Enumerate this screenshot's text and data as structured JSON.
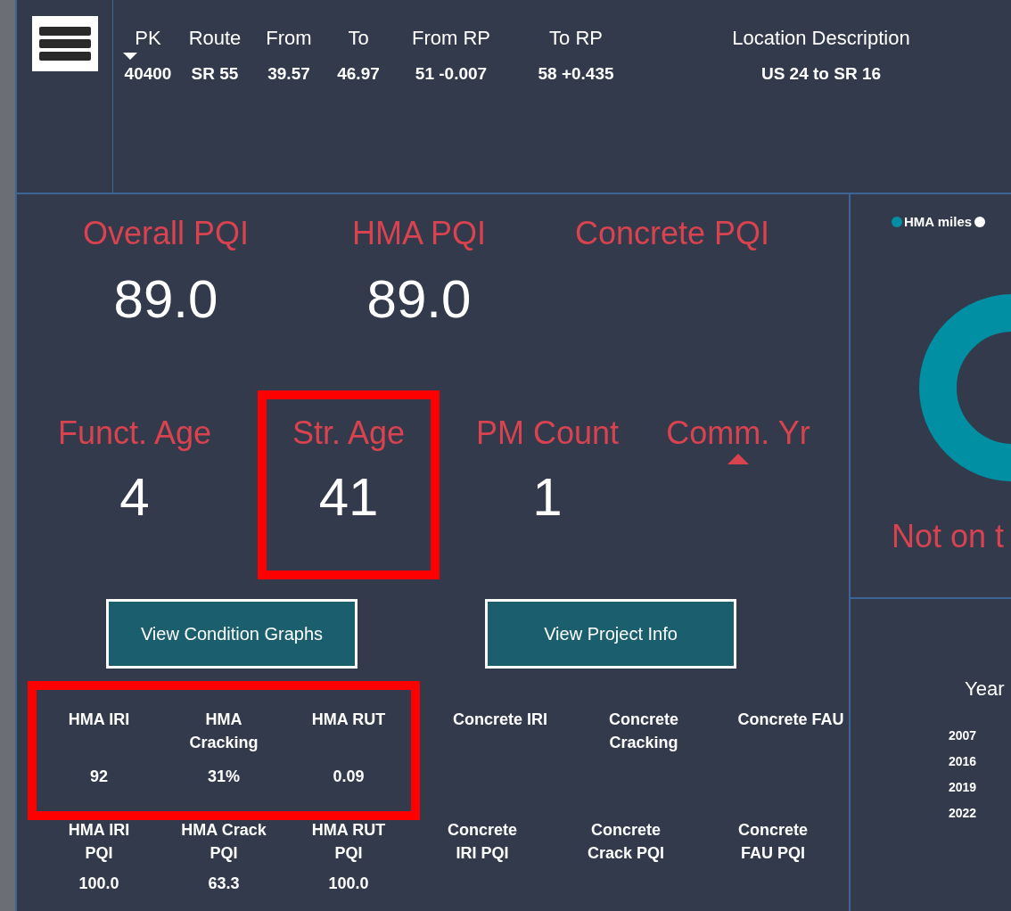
{
  "menu_button": {
    "kind": "hamburger"
  },
  "header": {
    "columns": [
      {
        "label": "PK",
        "value": "40400",
        "sorted": true
      },
      {
        "label": "Route",
        "value": "SR 55",
        "sorted": false
      },
      {
        "label": "From",
        "value": "39.57",
        "sorted": false
      },
      {
        "label": "To",
        "value": "46.97",
        "sorted": false
      },
      {
        "label": "From RP",
        "value": "51 -0.007",
        "sorted": false
      },
      {
        "label": "To RP",
        "value": "58 +0.435",
        "sorted": false
      },
      {
        "label": "Location Description",
        "value": "US 24 to SR 16",
        "sorted": false
      }
    ]
  },
  "pqi_metrics": [
    {
      "label": "Overall PQI",
      "value": "89.0"
    },
    {
      "label": "HMA PQI",
      "value": "89.0"
    },
    {
      "label": "Concrete PQI"
    }
  ],
  "age_metrics": [
    {
      "label": "Funct. Age",
      "value": "4",
      "highlighted": false,
      "sorted": false
    },
    {
      "label": "Str. Age",
      "value": "41",
      "highlighted": true,
      "sorted": false
    },
    {
      "label": "PM Count",
      "value": "1",
      "highlighted": false,
      "sorted": false
    },
    {
      "label": "Comm. Yr",
      "highlighted": false,
      "sorted": true
    }
  ],
  "buttons": [
    "View Condition Graphs",
    "View Project Info"
  ],
  "measures": [
    {
      "label": "HMA IRI",
      "value": "92",
      "highlighted": true
    },
    {
      "label": "HMA Cracking",
      "value": "31%",
      "highlighted": true
    },
    {
      "label": "HMA RUT",
      "value": "0.09",
      "highlighted": true
    },
    {
      "label": "Concrete IRI",
      "highlighted": false
    },
    {
      "label": "Concrete Cracking",
      "highlighted": false
    },
    {
      "label": "Concrete FAU",
      "highlighted": false
    }
  ],
  "pqi_measures": [
    {
      "label": "HMA IRI PQI",
      "value": "100.0"
    },
    {
      "label": "HMA Crack PQI",
      "value": "63.3"
    },
    {
      "label": "HMA RUT PQI",
      "value": "100.0"
    },
    {
      "label": "Concrete IRI PQI"
    },
    {
      "label": "Concrete Crack PQI"
    },
    {
      "label": "Concrete FAU PQI"
    }
  ],
  "donut_panel": {
    "legend": [
      {
        "label": "HMA miles",
        "color": "#008fa3"
      },
      {
        "color": "#ffffff"
      }
    ],
    "message": "Not on t"
  },
  "year_panel": {
    "header": "Year",
    "years": [
      "2007",
      "2016",
      "2019",
      "2022"
    ]
  }
}
